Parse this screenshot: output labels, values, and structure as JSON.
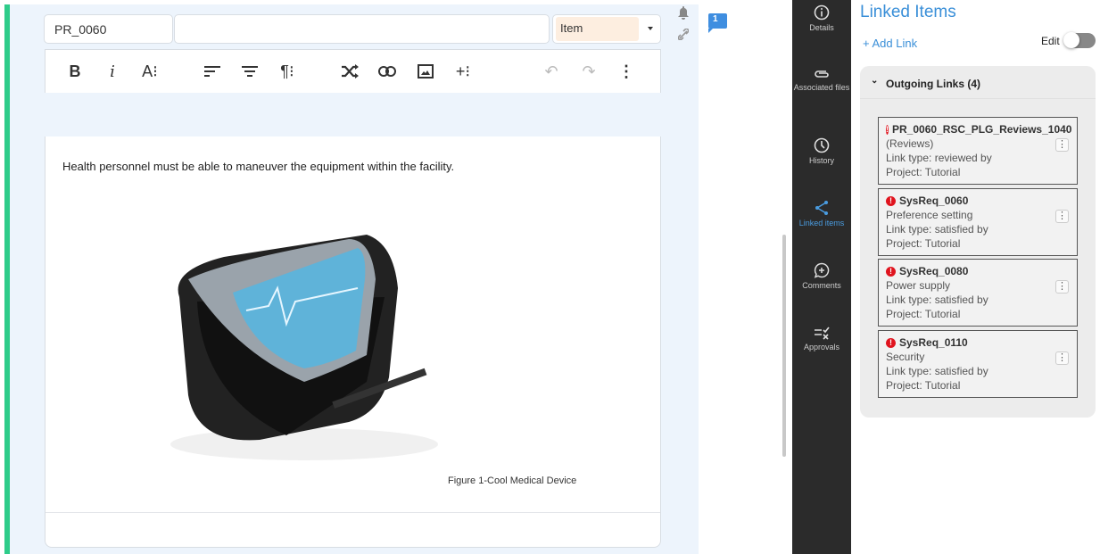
{
  "editor": {
    "item_id": "PR_0060",
    "title_value": "",
    "type_select": "Item",
    "body_text": "Health personnel must be able to maneuver the equipment within the facility.",
    "figure_caption": "Figure 1-Cool Medical Device",
    "comment_count": "1"
  },
  "toolbar": {
    "bold": "B",
    "italic": "i",
    "font": "A⁝",
    "paragraph": "¶⁝",
    "insert": "+⁝"
  },
  "sidebar": {
    "items": [
      {
        "label": "Details",
        "icon": "info-icon"
      },
      {
        "label": "Associated files",
        "icon": "paperclip-icon"
      },
      {
        "label": "History",
        "icon": "clock-icon"
      },
      {
        "label": "Linked items",
        "icon": "share-icon",
        "active": true
      },
      {
        "label": "Comments",
        "icon": "comment-plus-icon"
      },
      {
        "label": "Approvals",
        "icon": "approvals-icon"
      }
    ]
  },
  "panel": {
    "title": "Linked Items",
    "add_link": "+ Add Link",
    "edit_label": "Edit",
    "edit_on": false,
    "group_title": "Outgoing Links (4)",
    "links": [
      {
        "id": "PR_0060_RSC_PLG_Reviews_1040",
        "name": "(Reviews)",
        "link_type": "Link type: reviewed by",
        "project": "Project: Tutorial"
      },
      {
        "id": "SysReq_0060",
        "name": "Preference setting",
        "link_type": "Link type: satisfied by",
        "project": "Project: Tutorial"
      },
      {
        "id": "SysReq_0080",
        "name": "Power supply",
        "link_type": "Link type: satisfied by",
        "project": "Project: Tutorial"
      },
      {
        "id": "SysReq_0110",
        "name": "Security",
        "link_type": "Link type: satisfied by",
        "project": "Project: Tutorial"
      }
    ]
  },
  "colors": {
    "accent": "#3a8fd8",
    "status_bar": "#2ecc8a",
    "type_fill": "#fdeee0",
    "error": "#e0141e"
  }
}
